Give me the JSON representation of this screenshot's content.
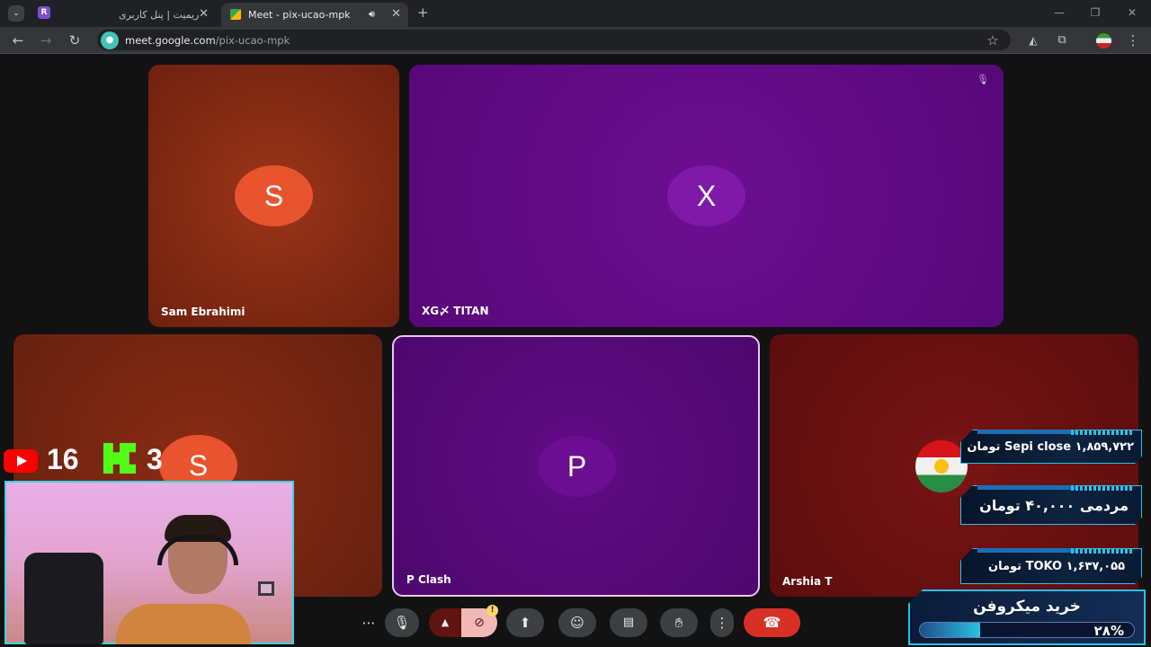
{
  "browser": {
    "tabs": [
      {
        "title": "ریمیت | پنل کاربری"
      },
      {
        "title": "Meet - pix-ucao-mpk"
      }
    ],
    "url_host": "meet.google.com",
    "url_path": "/pix-ucao-mpk"
  },
  "participants": [
    {
      "name": "Sam Ebrahimi",
      "initial": "S",
      "avatar_color": "#e8542d",
      "tile_color": "#8a2a12"
    },
    {
      "name": "XG〆 TITAN",
      "initial": "X",
      "avatar_color": "#7a12a3",
      "tile_color": "#5e0a82"
    },
    {
      "name": "",
      "initial": "S",
      "avatar_color": "#e8542d",
      "tile_color": "#7a2614"
    },
    {
      "name": "P Clash",
      "initial": "P",
      "avatar_color": "#6a0d8f",
      "tile_color": "#560a78"
    },
    {
      "name": "Arshia T",
      "initial": "",
      "avatar_color": "#7a1414",
      "tile_color": "#6b1010"
    }
  ],
  "controls": {
    "camera_badge": "!"
  },
  "stream_overlay": {
    "youtube_count": "16",
    "kick_count": "3",
    "donations": [
      {
        "text": "Sepi close  ۱,۸۵۹,۷۲۲ تومان"
      },
      {
        "text": "مردمی  ۴۰,۰۰۰ تومان"
      },
      {
        "text": "TOKO  ۱,۶۳۷,۰۵۵ تومان"
      }
    ],
    "goal": {
      "title": "خرید میکروفن",
      "percent_label": "۲۸%",
      "progress": 0.28
    }
  }
}
